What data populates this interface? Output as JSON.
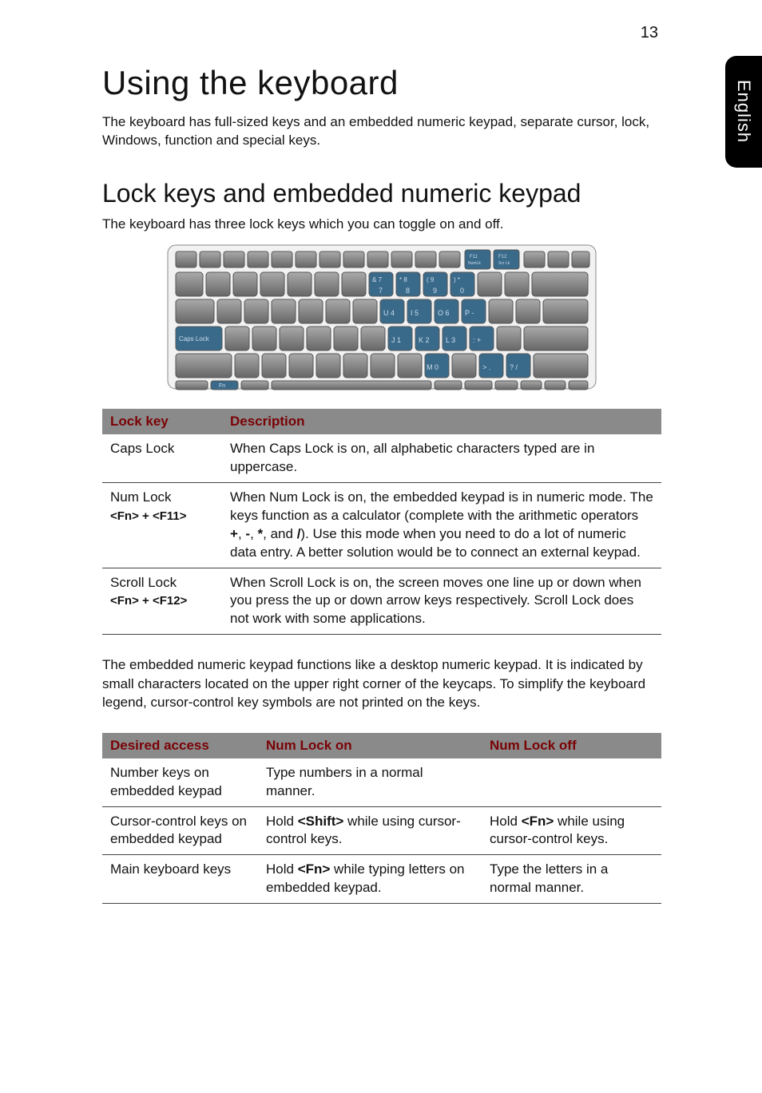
{
  "page_number": "13",
  "side_tab": "English",
  "h1": "Using the keyboard",
  "intro": "The keyboard has full-sized keys and an embedded numeric keypad, separate cursor, lock, Windows, function and special keys.",
  "h2": "Lock keys and embedded numeric keypad",
  "sub": "The keyboard has three lock keys which you can toggle on and off.",
  "table1": {
    "headers": [
      "Lock key",
      "Description"
    ],
    "rows": [
      {
        "key_line1": "Caps Lock",
        "key_line2": "",
        "desc": "When Caps Lock is on, all alphabetic characters typed are in uppercase."
      },
      {
        "key_line1": "Num Lock",
        "key_line2": "<Fn> + <F11>",
        "desc_before": "When Num Lock is on, the embedded keypad is in numeric mode. The keys function as a calculator (complete with the arithmetic operators ",
        "ops": "+",
        "desc_mid1": ", ",
        "ops2": "-",
        "desc_mid2": ", ",
        "ops3": "*",
        "desc_mid3": ", and ",
        "ops4": "/",
        "desc_after": "). Use this mode when you need to do a lot of numeric data entry. A better solution would be to connect an external keypad."
      },
      {
        "key_line1": "Scroll Lock",
        "key_line2": "<Fn> + <F12>",
        "desc": "When Scroll Lock is on, the screen moves one line up or down when you press the up or down arrow keys respectively. Scroll Lock does not work with some applications."
      }
    ]
  },
  "para": "The embedded numeric keypad functions like a desktop numeric keypad. It is indicated by small characters located on the upper right corner of the keycaps. To simplify the keyboard legend, cursor-control key symbols are not printed on the keys.",
  "table2": {
    "headers": [
      "Desired access",
      "Num Lock on",
      "Num Lock off"
    ],
    "rows": [
      {
        "c1": "Number keys on embedded keypad",
        "c2": "Type numbers in a normal manner.",
        "c3": ""
      },
      {
        "c1": "Cursor-control keys on embedded keypad",
        "c2_before": "Hold ",
        "c2_bold": "<Shift>",
        "c2_after": " while using cursor-control keys.",
        "c3_before": "Hold ",
        "c3_bold": "<Fn>",
        "c3_after": " while using cursor-control keys."
      },
      {
        "c1": "Main keyboard keys",
        "c2_before": "Hold ",
        "c2_bold": "<Fn>",
        "c2_after": " while typing letters on embedded keypad.",
        "c3": "Type the letters in a normal manner."
      }
    ]
  },
  "chart_data": {
    "type": "table",
    "tables": [
      {
        "title": "Lock keys",
        "columns": [
          "Lock key",
          "Description"
        ],
        "rows": [
          [
            "Caps Lock",
            "When Caps Lock is on, all alphabetic characters typed are in uppercase."
          ],
          [
            "Num Lock <Fn> + <F11>",
            "When Num Lock is on, the embedded keypad is in numeric mode. The keys function as a calculator (complete with the arithmetic operators +, -, *, and /). Use this mode when you need to do a lot of numeric data entry. A better solution would be to connect an external keypad."
          ],
          [
            "Scroll Lock <Fn> + <F12>",
            "When Scroll Lock is on, the screen moves one line up or down when you press the up or down arrow keys respectively. Scroll Lock does not work with some applications."
          ]
        ]
      },
      {
        "title": "Embedded keypad access",
        "columns": [
          "Desired access",
          "Num Lock on",
          "Num Lock off"
        ],
        "rows": [
          [
            "Number keys on embedded keypad",
            "Type numbers in a normal manner.",
            ""
          ],
          [
            "Cursor-control keys on embedded keypad",
            "Hold <Shift> while using cursor-control keys.",
            "Hold <Fn> while using cursor-control keys."
          ],
          [
            "Main keyboard keys",
            "Hold <Fn> while typing letters on embedded keypad.",
            "Type the letters in a normal manner."
          ]
        ]
      }
    ]
  }
}
